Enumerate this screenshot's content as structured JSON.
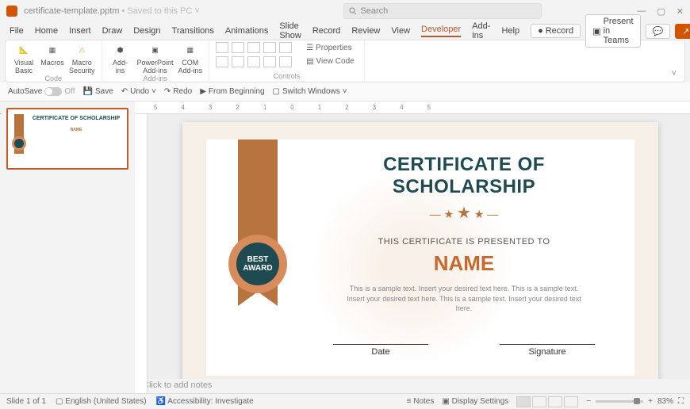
{
  "title": {
    "filename": "certificate-template.pptm",
    "saved": " • Saved to this PC",
    "dropdown": "˅"
  },
  "search": {
    "placeholder": "Search"
  },
  "menu": {
    "file": "File",
    "home": "Home",
    "insert": "Insert",
    "draw": "Draw",
    "design": "Design",
    "transitions": "Transitions",
    "animations": "Animations",
    "slideshow": "Slide Show",
    "record": "Record",
    "review": "Review",
    "view": "View",
    "developer": "Developer",
    "addins": "Add-ins",
    "help": "Help"
  },
  "topright": {
    "record": "Record",
    "present": "Present in Teams",
    "share": "Share"
  },
  "ribbon": {
    "code": {
      "vb": "Visual\nBasic",
      "macros": "Macros",
      "security": "Macro\nSecurity",
      "label": "Code"
    },
    "addins": {
      "addins": "Add-\nins",
      "ppt": "PowerPoint\nAdd-ins",
      "com": "COM\nAdd-ins",
      "label": "Add-ins"
    },
    "controls": {
      "properties": "Properties",
      "viewcode": "View Code",
      "label": "Controls"
    }
  },
  "qat": {
    "autosave": "AutoSave",
    "off": "Off",
    "save": "Save",
    "undo": "Undo",
    "redo": "Redo",
    "frombeg": "From Beginning",
    "switch": "Switch Windows"
  },
  "ruler": [
    "5",
    "4",
    "3",
    "2",
    "1",
    "0",
    "1",
    "2",
    "3",
    "4",
    "5"
  ],
  "thumb": {
    "num": "1"
  },
  "cert": {
    "title": "CERTIFICATE OF SCHOLARSHIP",
    "sub": "THIS CERTIFICATE IS PRESENTED TO",
    "name": "NAME",
    "desc": "This is a sample text. Insert your desired text here. This is a sample text. Insert your desired text here. This is a sample text. Insert your desired text here.",
    "date": "Date",
    "sig": "Signature",
    "badge1": "BEST",
    "badge2": "AWARD"
  },
  "notes": "Click to add notes",
  "status": {
    "slide": "Slide 1 of 1",
    "lang": "English (United States)",
    "access": "Accessibility: Investigate",
    "notes": "Notes",
    "display": "Display Settings",
    "zoom": "83%"
  }
}
